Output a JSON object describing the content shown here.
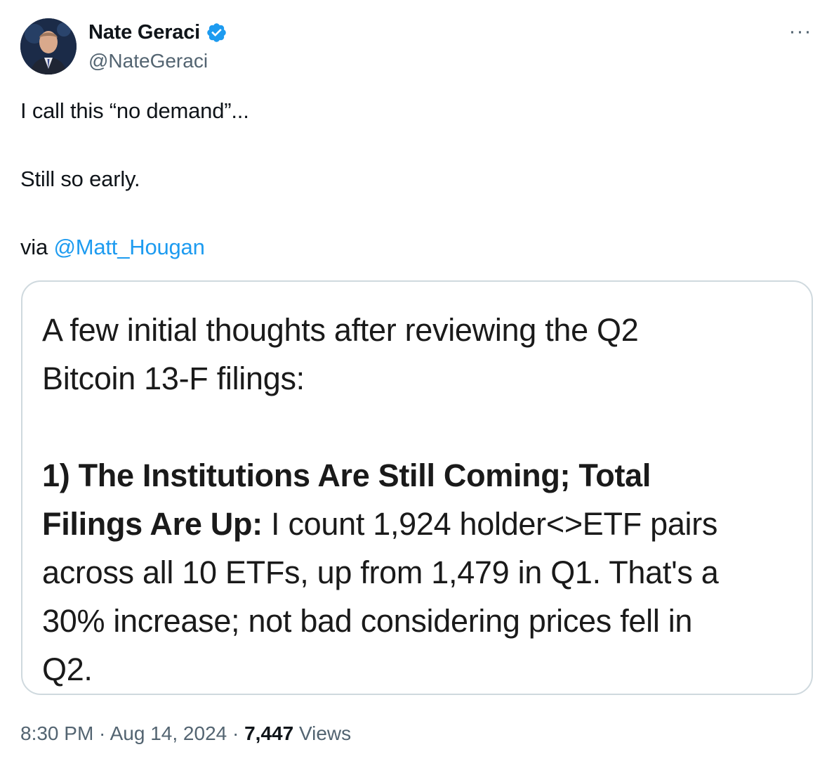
{
  "author": {
    "display_name": "Nate Geraci",
    "handle": "@NateGeraci",
    "verified_icon": "verified-badge-icon",
    "avatar_icon": "profile-photo"
  },
  "more_icon": "more-horizontal-icon",
  "more_label": "···",
  "tweet": {
    "line1": "I call this “no demand”...",
    "line2": "Still so early.",
    "line3_prefix": "via ",
    "line3_mention": "@Matt_Hougan"
  },
  "quote": {
    "line1": "A few initial thoughts after reviewing the Q2",
    "line2": "Bitcoin 13-F filings:",
    "line3": "1) The Institutions Are Still Coming; Total",
    "line4_bold": "Filings Are Up:",
    "line4_rest": " I count 1,924 holder<>ETF pairs",
    "line5": "across all 10 ETFs, up from 1,479 in Q1. That's a",
    "line6": "30% increase; not bad considering prices fell in",
    "line7": "Q2."
  },
  "meta": {
    "time": "8:30 PM",
    "separator": " · ",
    "date": "Aug 14, 2024",
    "views_count": "7,447",
    "views_label": " Views"
  },
  "colors": {
    "link": "#1d9bf0",
    "secondary_text": "#536471",
    "border": "#cfd9de"
  }
}
